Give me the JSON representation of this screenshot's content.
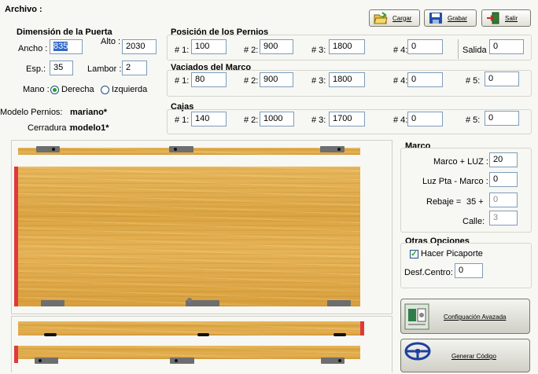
{
  "menu": {
    "archivo": "Archivo :"
  },
  "toolbar": {
    "cargar": "Cargar",
    "grabar": "Grabar",
    "salir": "Salir"
  },
  "dimension": {
    "title": "Dimensión de la Puerta",
    "ancho_label": "Ancho :",
    "ancho_value": "835",
    "alto_label": "Alto :",
    "alto_value": "2030",
    "esp_label": "Esp.:",
    "esp_value": "35",
    "lambor_label": "Lambor :",
    "lambor_value": "2",
    "mano_label": "Mano :",
    "derecha": "Derecha",
    "izquierda": "Izquierda",
    "mano_selected": "Derecha"
  },
  "modelo": {
    "pernos_label": "Modelo Pernios:",
    "pernos_value": "mariano*",
    "cerradura_label": "Cerradura :",
    "cerradura_value": "modelo1*"
  },
  "pernios": {
    "title": "Posición de los Pernios",
    "p1_label": "# 1:",
    "p1": "100",
    "p2_label": "# 2:",
    "p2": "900",
    "p3_label": "# 3:",
    "p3": "1800",
    "p4_label": "# 4:",
    "p4": "0",
    "salida_label": "Salida :",
    "salida": "0"
  },
  "vaciados": {
    "title": "Vaciados del Marco",
    "v1_label": "# 1:",
    "v1": "80",
    "v2_label": "# 2:",
    "v2": "900",
    "v3_label": "# 3:",
    "v3": "1800",
    "v4_label": "# 4:",
    "v4": "0",
    "v5_label": "# 5:",
    "v5": "0"
  },
  "cajas": {
    "title": "Cajas",
    "c1_label": "# 1:",
    "c1": "140",
    "c2_label": "# 2:",
    "c2": "1000",
    "c3_label": "# 3:",
    "c3": "1700",
    "c4_label": "# 4:",
    "c4": "0",
    "c5_label": "# 5:",
    "c5": "0"
  },
  "marco": {
    "title": "Marco",
    "marco_luz_label": "Marco + LUZ :",
    "marco_luz": "20",
    "luz_pta_label": "Luz Pta - Marco :",
    "luz_pta": "0",
    "rebaje_label": "Rebaje =",
    "rebaje_base": "35 +",
    "rebaje": "0",
    "calle_label": "Calle:",
    "calle": "3"
  },
  "otras": {
    "title": "Otras Opciones",
    "picaporte_label": "Hacer Picaporte",
    "picaporte_checked": true,
    "desf_label": "Desf.Centro:",
    "desf": "0"
  },
  "buttons": {
    "config": "Configuación Avazada",
    "generar": "Generar Código"
  },
  "icons": {
    "cargar": "folder-open-icon",
    "grabar": "floppy-disk-icon",
    "salir": "exit-door-icon",
    "config": "settings-panel-icon",
    "generar": "steering-wheel-icon"
  }
}
